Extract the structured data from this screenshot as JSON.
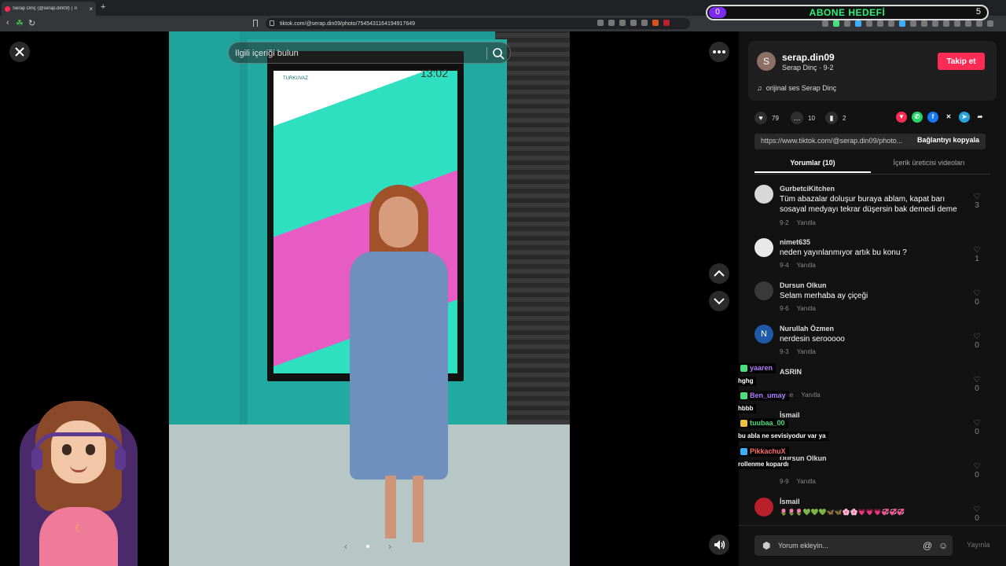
{
  "browser": {
    "tab_title": "Serap Dinç (@serap.din09) | Ti",
    "url": "tiktok.com/@serap.din09/photo/7545431164194917649"
  },
  "goal": {
    "current": "0",
    "label": "ABONE HEDEFİ",
    "target": "5"
  },
  "viewer": {
    "search_placeholder": "İlgili içeriği bulun",
    "screen_time": "13:02",
    "screen_brand": "TURKUVAZ"
  },
  "author": {
    "avatar_letter": "S",
    "username": "serap.din09",
    "subline": "Serap Dinç · 9-2",
    "follow_label": "Takip et",
    "music": "orijinal ses Serap Dinç"
  },
  "actions": {
    "likes": "79",
    "comments": "10",
    "saves": "2"
  },
  "link": {
    "url": "https://www.tiktok.com/@serap.din09/photo...",
    "copy_label": "Bağlantıyı kopyala"
  },
  "tabs": {
    "comments": "Yorumlar (10)",
    "creator_videos": "İçerik üreticisi videoları"
  },
  "comments": [
    {
      "user": "GurbetciKitchen",
      "text": "Tüm abazalar doluşur buraya ablam, kapat barı sosayal medyayı tekrar düşersin bak demedi deme",
      "date": "9-2",
      "reply": "Yanıtla",
      "likes": "3",
      "avatar_color": "#d8d8d8"
    },
    {
      "user": "nimet635",
      "text": "neden yayınlanmıyor artık bu konu ?",
      "date": "9-4",
      "reply": "Yanıtla",
      "likes": "1",
      "avatar_color": "#e8e8e8"
    },
    {
      "user": "Dursun Olkun",
      "text": "Selam merhaba ay çiçeği",
      "date": "9-6",
      "reply": "Yanıtla",
      "likes": "0",
      "avatar_color": "#3a3a3a"
    },
    {
      "user": "Nurullah Özmen",
      "text": "nerdesin serooooo",
      "date": "9-3",
      "reply": "Yanıtla",
      "likes": "0",
      "avatar_color": "#1f5aa8",
      "letter": "N"
    },
    {
      "user": "ASRIN",
      "text": "",
      "date": "önce",
      "reply": "Yanıtla",
      "likes": "0",
      "avatar_color": "#555"
    },
    {
      "user": "İsmail",
      "text": "",
      "date": "",
      "reply": "",
      "likes": "0",
      "avatar_color": "#555"
    },
    {
      "user": "Dursun Olkun",
      "text": "",
      "date": "9-9",
      "reply": "Yanıtla",
      "likes": "0",
      "avatar_color": "#555"
    },
    {
      "user": "İsmail",
      "text": "🌷🌷🌷💚💚💚🦋🦋🌸🌸💗💗💗💞💞💞",
      "date": "",
      "reply": "",
      "likes": "0",
      "avatar_color": "#b8202a"
    }
  ],
  "comment_bar": {
    "placeholder": "Yorum ekleyin...",
    "post_label": "Yayınla"
  },
  "chat": [
    {
      "name": "yaaren",
      "text": "hghg",
      "color": "#b07cff",
      "badge": "#4ade80"
    },
    {
      "name": "Ben_umay",
      "text": "hbbb",
      "color": "#b07cff",
      "badge": "#4ade80"
    },
    {
      "name": "tuubaa_00",
      "text": "bu abla ne sevisiyodur var ya",
      "color": "#4ade80",
      "badge": "#f0c040"
    },
    {
      "name": "PikkachuX",
      "text": "rollenme kopardı",
      "color": "#ff6b6b",
      "badge": "#3ab0ff"
    }
  ]
}
